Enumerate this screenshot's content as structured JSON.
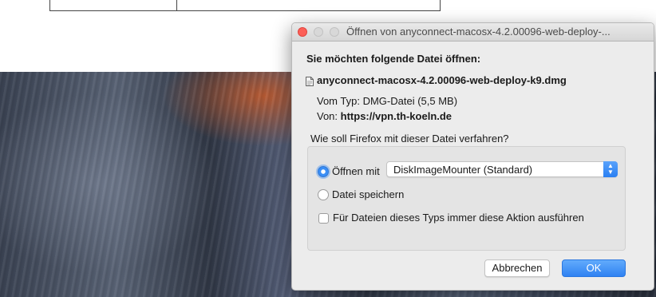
{
  "dialog": {
    "title": "Öffnen von anyconnect-macosx-4.2.00096-web-deploy-...",
    "heading": "Sie möchten folgende Datei öffnen:",
    "file_icon": "document-icon",
    "filename": "anyconnect-macosx-4.2.00096-web-deploy-k9.dmg",
    "type_label": "Vom Typ:",
    "type_value": "DMG-Datei (5,5 MB)",
    "from_label": "Von:",
    "from_value": "https://vpn.th-koeln.de",
    "question": "Wie soll Firefox mit dieser Datei verfahren?",
    "options": {
      "open_label": "Öffnen mit",
      "open_selected": true,
      "app_select_value": "DiskImageMounter (Standard)",
      "save_label": "Datei speichern",
      "save_selected": false,
      "always_label": "Für Dateien dieses Typs immer diese Aktion ausführen",
      "always_checked": false
    },
    "buttons": {
      "cancel": "Abbrechen",
      "ok": "OK"
    }
  },
  "colors": {
    "accent": "#2f82f2",
    "close_light": "#fc5f57"
  }
}
